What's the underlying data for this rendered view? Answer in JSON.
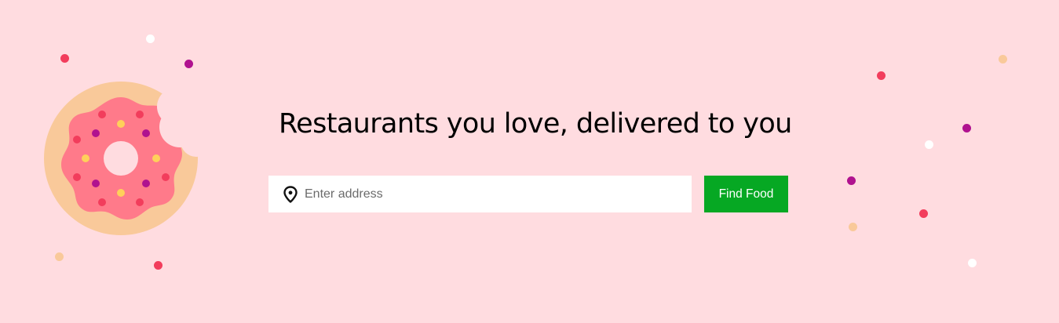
{
  "hero": {
    "headline": "Restaurants you love, delivered to you",
    "address_placeholder": "Enter address",
    "address_value": "",
    "find_button_label": "Find Food",
    "icons": {
      "illustration": "donut-illustration",
      "location": "location-pin-icon"
    }
  },
  "colors": {
    "background": "#ffdce0",
    "button": "#06a823",
    "button_text": "#ffffff",
    "donut_dough": "#f9c99a",
    "donut_frosting": "#ff7a8a",
    "sprinkle_red": "#f23d5c",
    "sprinkle_purple": "#b0128f",
    "sprinkle_yellow": "#ffd05a",
    "confetti_white": "#ffffff",
    "confetti_peach": "#f9c99a"
  }
}
